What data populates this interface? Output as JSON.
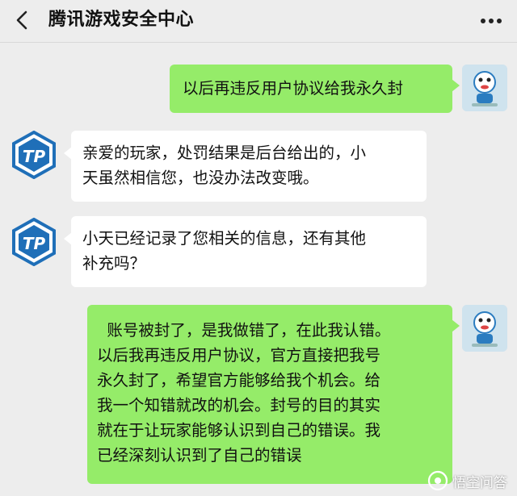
{
  "header": {
    "title": "腾讯游戏安全中心",
    "back_icon": "chevron-left-icon",
    "more_icon": "more-dots-icon"
  },
  "messages": [
    {
      "sender": "user",
      "lines": [
        "以后再违反用户协议给我永久封"
      ]
    },
    {
      "sender": "tp",
      "lines": [
        "亲爱的玩家，处罚结果是后台给出的，小",
        "天虽然相信您，也没办法改变哦。"
      ]
    },
    {
      "sender": "tp",
      "lines": [
        "小天已经记录了您相关的信息，还有其他",
        "补充吗？"
      ]
    },
    {
      "sender": "user",
      "lines": [
        "  账号被封了，是我做错了，在此我认错。",
        "以后我再违反用户协议，官方直接把我号",
        "永久封了，希望官方能够给我个机会。给",
        "我一个知错就改的机会。封号的目的其实",
        "就在于让玩家能够认识到自己的错误。我",
        "已经深刻认识到了自己的错误"
      ]
    }
  ],
  "avatars": {
    "tp_label": "TP",
    "tp_color": "#1f6fb8",
    "user_color": "#cfe3ee"
  },
  "watermark": {
    "text": "悟空问答"
  },
  "colors": {
    "background": "#ededed",
    "user_bubble": "#95ec69",
    "bot_bubble": "#ffffff"
  }
}
